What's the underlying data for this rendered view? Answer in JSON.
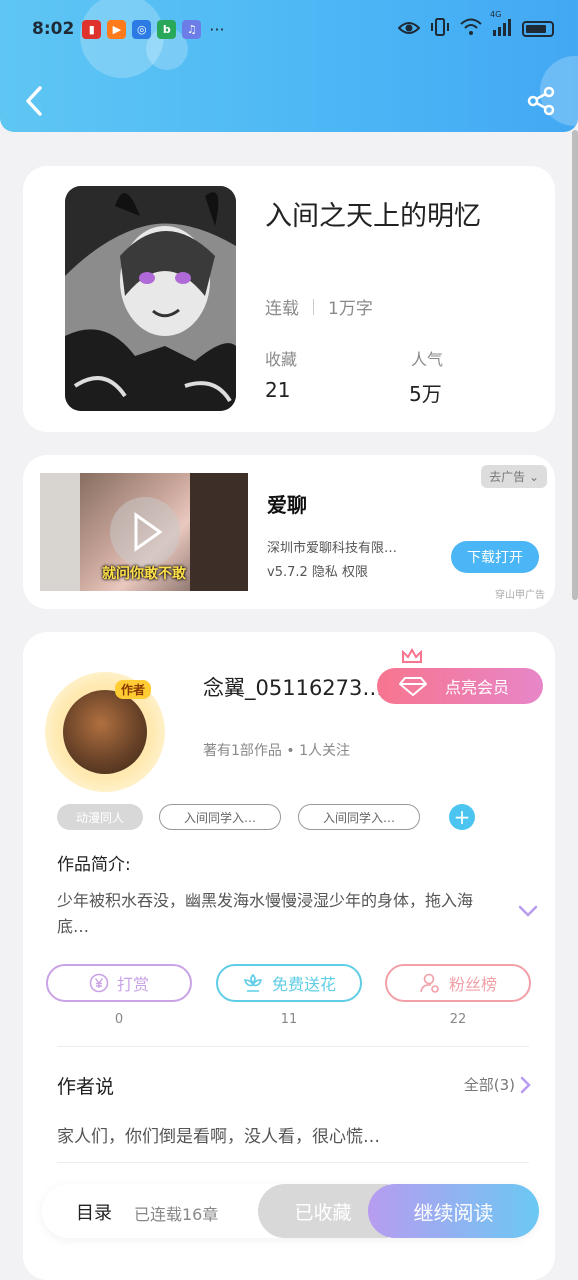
{
  "status_bar": {
    "time": "8:02",
    "more": "···",
    "network": "4G"
  },
  "book": {
    "title": "入间之天上的明忆",
    "status": "连载",
    "word_count": "1万字",
    "favorites_label": "收藏",
    "favorites_value": "21",
    "popularity_label": "人气",
    "popularity_value": "5万"
  },
  "ad": {
    "badge": "去广告",
    "app_name": "爱聊",
    "caption": "就问你敢不敢",
    "company": "深圳市爱聊科技有限…",
    "version_line": "v5.7.2  隐私  权限",
    "button": "下载打开",
    "source": "穿山甲广告"
  },
  "author": {
    "avatar_tag": "作者",
    "name": "念翼_05116273…",
    "vip_button": "点亮会员",
    "stats": "著有1部作品 • 1人关注",
    "tags": [
      "动漫同人",
      "入间同学入…",
      "入间同学入…"
    ],
    "add_tag": "+",
    "intro_heading": "作品简介:",
    "intro_text": "少年被积水吞没，幽黑发海水慢慢浸湿少年的身体，拖入海底…"
  },
  "actions": [
    {
      "label": "打赏",
      "count": "0",
      "icon": "yen-icon",
      "color": "#c9a3e6"
    },
    {
      "label": "免费送花",
      "count": "11",
      "icon": "flower-icon",
      "color": "#5fcde6"
    },
    {
      "label": "粉丝榜",
      "count": "22",
      "icon": "fans-icon",
      "color": "#f2a0a8"
    }
  ],
  "author_says": {
    "heading": "作者说",
    "all_label": "全部(3)",
    "text": "家人们，你们倒是看啊，没人看，很心慌…"
  },
  "bottom_bar": {
    "toc": "目录",
    "chapters": "已连载16章",
    "collected": "已收藏",
    "continue": "继续阅读"
  }
}
